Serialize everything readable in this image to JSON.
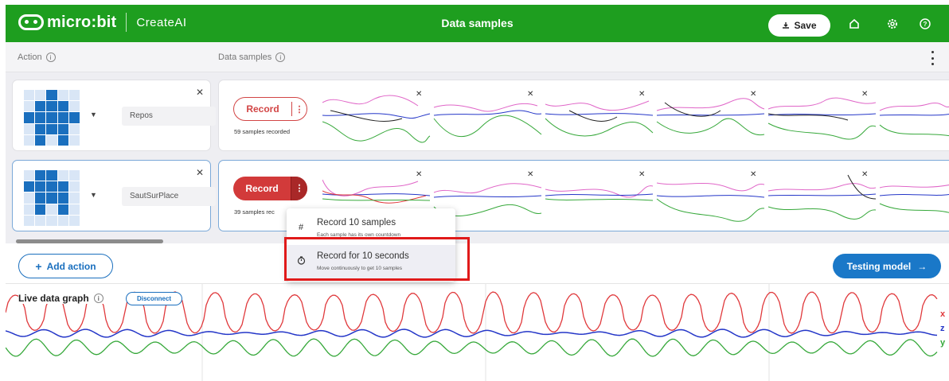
{
  "header": {
    "brand": "micro:bit",
    "product": "CreateAI",
    "title": "Data samples",
    "save_label": "Save",
    "brand_color": "#1e9e1f"
  },
  "columns": {
    "action_label": "Action",
    "samples_label": "Data samples"
  },
  "actions": [
    {
      "name": "Repos",
      "record_label": "Record",
      "samples_text": "59 samples recorded",
      "led_pattern": [
        0,
        0,
        1,
        0,
        0,
        0,
        1,
        1,
        1,
        0,
        1,
        1,
        1,
        1,
        1,
        0,
        1,
        1,
        1,
        0,
        0,
        1,
        0,
        1,
        0
      ]
    },
    {
      "name": "SautSurPlace",
      "record_label": "Record",
      "samples_text": "39 samples rec",
      "led_pattern": [
        0,
        1,
        1,
        0,
        0,
        1,
        1,
        1,
        1,
        0,
        0,
        1,
        1,
        1,
        0,
        0,
        1,
        0,
        1,
        0,
        0,
        0,
        0,
        0,
        0
      ]
    }
  ],
  "menu": {
    "items": [
      {
        "icon": "#",
        "title": "Record 10 samples",
        "subtitle": "Each sample has its own countdown"
      },
      {
        "icon": "timer-icon",
        "title": "Record for 10 seconds",
        "subtitle": "Move continuously to get 10 samples"
      }
    ]
  },
  "bottom": {
    "add_action_label": "Add action",
    "testing_label": "Testing model"
  },
  "live": {
    "title": "Live data graph",
    "disconnect_label": "Disconnect",
    "axes": [
      {
        "name": "x",
        "color": "#e0393c"
      },
      {
        "name": "z",
        "color": "#2436c8"
      },
      {
        "name": "y",
        "color": "#36a83a"
      }
    ]
  },
  "colors": {
    "accent_blue": "#1a6fbe",
    "record_red": "#d23a3a",
    "highlight_red": "#e01a1a",
    "x_red": "#e0393c",
    "y_green": "#36a83a",
    "z_blue": "#2436c8",
    "pink": "#e066c8"
  }
}
